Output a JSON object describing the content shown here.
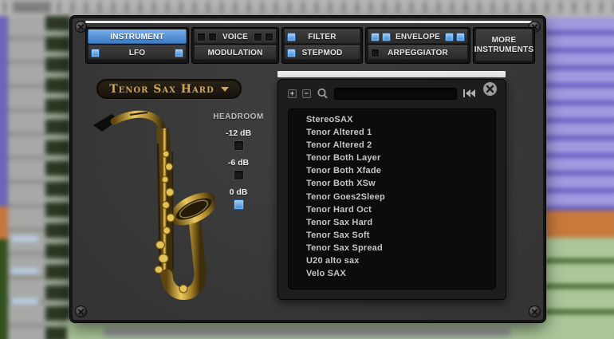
{
  "colors": {
    "led_on_blue": "#4f9be4",
    "active_tab_blue": "#4a86cc",
    "preset_gold": "#c9a55e",
    "panel_gray": "#3a3a3a",
    "browser_black": "#1d1d1d"
  },
  "tabs": {
    "instrument": {
      "label": "INSTRUMENT",
      "active": true
    },
    "lfo": {
      "label": "LFO",
      "led_left": true,
      "led_right": true
    },
    "voice": {
      "label": "VOICE",
      "led_left_1": false,
      "led_left_2": false,
      "led_right_1": false,
      "led_right_2": false
    },
    "modulation": {
      "label": "MODULATION"
    },
    "filter": {
      "label": "FILTER",
      "led_left": true
    },
    "stepmod": {
      "label": "STEPMOD",
      "led_left": true
    },
    "envelope": {
      "label": "ENVELOPE",
      "led_left_1": true,
      "led_left_2": true,
      "led_right_1": true,
      "led_right_2": true
    },
    "arpeggiator": {
      "label": "ARPEGGIATOR",
      "led_left": false
    },
    "more_instruments": {
      "label": "MORE INSTRUMENTS"
    }
  },
  "preset_selector": {
    "value": "Tenor Sax Hard"
  },
  "headroom": {
    "title": "HEADROOM",
    "options": [
      {
        "label": "-12 dB",
        "on": false
      },
      {
        "label": "-6 dB",
        "on": false
      },
      {
        "label": "0 dB",
        "on": true
      }
    ]
  },
  "browser": {
    "search_value": "",
    "toolbar": {
      "expand": "+",
      "collapse": "−"
    },
    "items": [
      "StereoSAX",
      "Tenor Altered 1",
      "Tenor Altered 2",
      "Tenor Both Layer",
      "Tenor Both Xfade",
      "Tenor Both XSw",
      "Tenor Goes2Sleep",
      "Tenor Hard Oct",
      "Tenor Sax Hard",
      "Tenor Sax Soft",
      "Tenor Sax Spread",
      "U20 alto sax",
      "Velo SAX"
    ]
  }
}
